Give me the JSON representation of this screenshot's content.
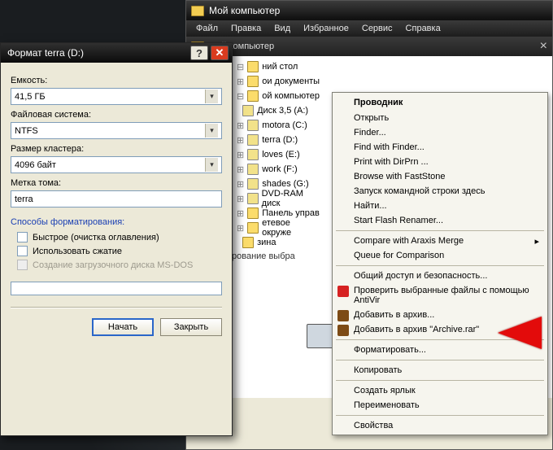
{
  "explorer": {
    "title": "Мой компьютер",
    "menus": [
      "Файл",
      "Правка",
      "Вид",
      "Избранное",
      "Сервис",
      "Справка"
    ],
    "address_label": "Мой компьютер",
    "tree": [
      {
        "label": "ний стол"
      },
      {
        "label": "ои документы"
      },
      {
        "label": "ой компьютер"
      },
      {
        "label": "Диск 3,5 (A:)"
      },
      {
        "label": "motora (C:)"
      },
      {
        "label": "terra (D:)"
      },
      {
        "label": "loves (E:)"
      },
      {
        "label": "work (F:)"
      },
      {
        "label": "shades (G:)"
      },
      {
        "label": "DVD-RAM диск"
      },
      {
        "label": "Панель управ"
      },
      {
        "label": "етевое окруже"
      },
      {
        "label": "зина"
      }
    ],
    "selection_msg": "рование выбра",
    "taskbar_caption": "Мой компьютер"
  },
  "context_menu": {
    "header": "Проводник",
    "groups": [
      [
        {
          "label": "Открыть"
        },
        {
          "label": "Finder..."
        },
        {
          "label": "Find with Finder..."
        },
        {
          "label": "Print with DirPrn ..."
        },
        {
          "label": "Browse with FastStone"
        },
        {
          "label": "Запуск командной строки здесь"
        },
        {
          "label": "Найти..."
        },
        {
          "label": "Start Flash Renamer..."
        }
      ],
      [
        {
          "label": "Compare with Araxis Merge"
        },
        {
          "label": "Queue for Comparison"
        }
      ],
      [
        {
          "label": "Общий доступ и безопасность..."
        },
        {
          "label": "Проверить выбранные файлы с помощью AntiVir",
          "icon": "avir"
        },
        {
          "label": "Добавить в архив...",
          "icon": "rar"
        },
        {
          "label": "Добавить в архив \"Archive.rar\"",
          "icon": "rar"
        }
      ],
      [
        {
          "label": "Форматировать..."
        }
      ],
      [
        {
          "label": "Копировать"
        }
      ],
      [
        {
          "label": "Создать ярлык"
        },
        {
          "label": "Переименовать"
        }
      ],
      [
        {
          "label": "Свойства"
        }
      ]
    ]
  },
  "format_dialog": {
    "title": "Формат terra (D:)",
    "capacity_label": "Емкость:",
    "capacity_value": "41,5 ГБ",
    "filesystem_label": "Файловая система:",
    "filesystem_value": "NTFS",
    "cluster_label": "Размер кластера:",
    "cluster_value": "4096 байт",
    "volume_label_caption": "Метка тома:",
    "volume_label_value": "terra",
    "methods_caption": "Способы форматирования:",
    "opt_quick": "Быстрое (очистка оглавления)",
    "opt_compress": "Использовать сжатие",
    "opt_msdos": "Создание загрузочного диска MS-DOS",
    "btn_start": "Начать",
    "btn_close": "Закрыть"
  }
}
